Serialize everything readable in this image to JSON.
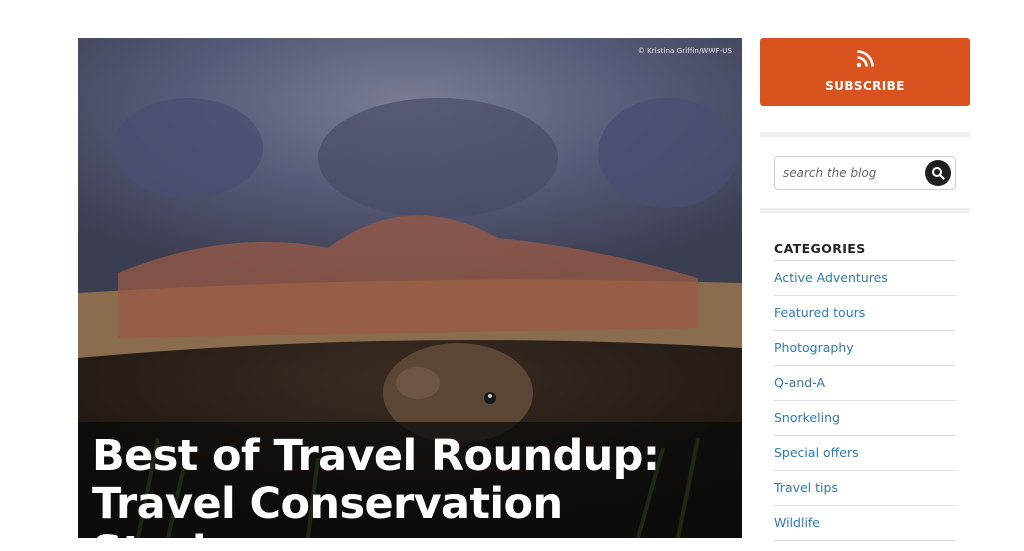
{
  "hero": {
    "credit": "© Kristina Griffin/WWF-US",
    "title_line1": "Best of Travel Roundup:",
    "title_line2": "Travel Conservation Stories",
    "image_subject": "giant tortoise"
  },
  "sidebar": {
    "subscribe": {
      "label": "SUBSCRIBE",
      "icon": "rss-icon",
      "color": "#d9531e"
    },
    "search": {
      "placeholder": "search the blog",
      "icon": "search-icon"
    },
    "categories": {
      "heading": "CATEGORIES",
      "items": [
        {
          "label": "Active Adventures"
        },
        {
          "label": "Featured tours"
        },
        {
          "label": "Photography"
        },
        {
          "label": "Q-and-A"
        },
        {
          "label": "Snorkeling"
        },
        {
          "label": "Special offers"
        },
        {
          "label": "Travel tips"
        },
        {
          "label": "Wildlife"
        }
      ]
    }
  },
  "colors": {
    "link": "#2e7ab4",
    "accent": "#d9531e",
    "text": "#222222"
  }
}
